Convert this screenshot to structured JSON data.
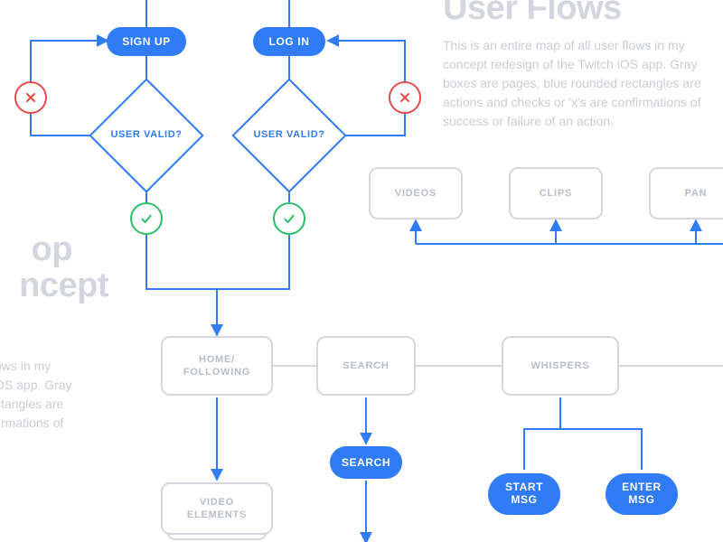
{
  "title_right": "User Flows",
  "desc_right": "This is an entire map of all user flows in my concept redesign of the Twitch iOS app. Gray boxes are pages, blue rounded rectangles are actions and checks or 'x's are confirmations of success or failure of an action.",
  "title_left_line1": "op",
  "title_left_line2": "ncept",
  "desc_left": "ows in my\nOS app. Gray\nctangles are\nfirmations of",
  "actions": {
    "signup": "SIGN UP",
    "login": "LOG IN",
    "search": "SEARCH",
    "start_msg": "START\nMSG",
    "enter_msg": "ENTER\nMSG"
  },
  "pages": {
    "videos": "VIDEOS",
    "clips": "CLIPS",
    "pan": "PAN",
    "home": "HOME/\nFOLLOWING",
    "search_page": "SEARCH",
    "whispers": "WHISPERS",
    "video_elements": "VIDEO\nELEMENTS"
  },
  "decision": "USER\nVALID?"
}
